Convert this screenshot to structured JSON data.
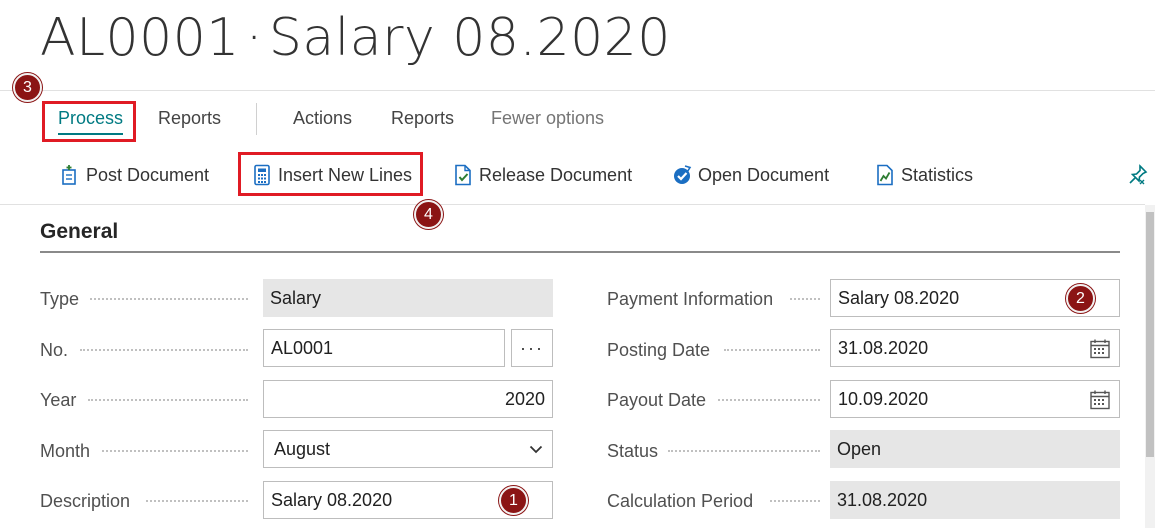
{
  "page": {
    "title_code": "AL0001",
    "title_separator": "·",
    "title_name": "Salary 08.2020"
  },
  "menu": {
    "tabs": [
      "Process",
      "Reports",
      "Actions",
      "Reports",
      "Fewer options"
    ],
    "active_tab": "Process"
  },
  "actions": {
    "post_document": "Post Document",
    "insert_new_lines": "Insert New Lines",
    "release_document": "Release Document",
    "open_document": "Open Document",
    "statistics": "Statistics"
  },
  "section": {
    "title": "General"
  },
  "fields_left": {
    "type": {
      "label": "Type",
      "value": "Salary"
    },
    "no": {
      "label": "No.",
      "value": "AL0001",
      "lookup_label": "···"
    },
    "year": {
      "label": "Year",
      "value": "2020"
    },
    "month": {
      "label": "Month",
      "value": "August"
    },
    "description": {
      "label": "Description",
      "value": "Salary 08.2020"
    }
  },
  "fields_right": {
    "payment_information": {
      "label": "Payment Information",
      "value": "Salary 08.2020"
    },
    "posting_date": {
      "label": "Posting Date",
      "value": "31.08.2020"
    },
    "payout_date": {
      "label": "Payout Date",
      "value": "10.09.2020"
    },
    "status": {
      "label": "Status",
      "value": "Open"
    },
    "calculation_period": {
      "label": "Calculation Period",
      "value": "31.08.2020"
    }
  },
  "callouts": [
    "1",
    "2",
    "3",
    "4"
  ],
  "colors": {
    "accent": "#007a82",
    "callout_red": "#e01b24",
    "badge": "#8b1414",
    "icon_blue": "#1b6ec2"
  }
}
